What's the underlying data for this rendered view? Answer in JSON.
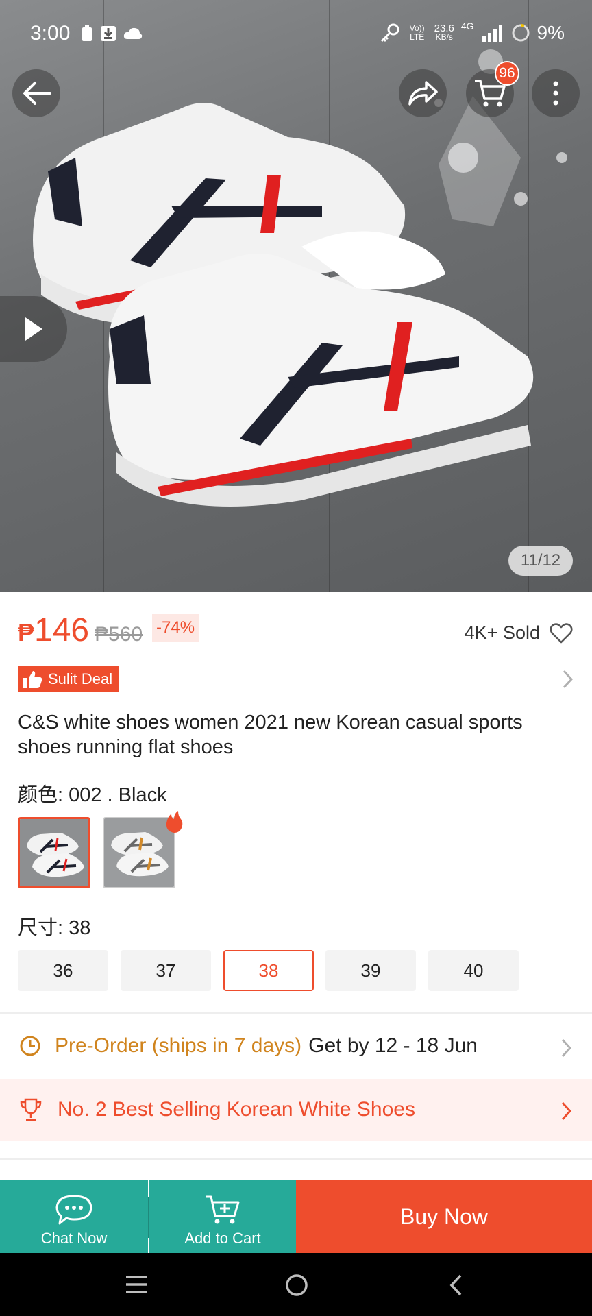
{
  "status_bar": {
    "time": "3:00",
    "network_label": "Vo)) LTE",
    "speed": "23.6",
    "speed_unit": "KB/s",
    "signal_label": "4G",
    "battery": "9%"
  },
  "gallery": {
    "counter": "11/12",
    "cart_count": "96"
  },
  "product": {
    "currency": "₱",
    "price": "146",
    "original_price": "₱560",
    "discount": "-74%",
    "sold": "4K+ Sold",
    "deal_label": "Sulit Deal",
    "title": "C&S white shoes women 2021 new Korean casual sports shoes running flat shoes"
  },
  "variants": {
    "color_label": "颜色: 002 . Black",
    "size_label": "尺寸: 38",
    "sizes": [
      "36",
      "37",
      "38",
      "39",
      "40"
    ],
    "selected_size": "38"
  },
  "shipping": {
    "preorder_text": "Pre-Order (ships in 7 days)",
    "delivery_text": "Get by 12 - 18 Jun"
  },
  "ranking": {
    "text": "No. 2 Best Selling Korean White Shoes"
  },
  "bottom_bar": {
    "chat_label": "Chat Now",
    "cart_label": "Add to Cart",
    "buy_label": "Buy Now"
  },
  "colors": {
    "accent": "#ee4d2d",
    "teal": "#26aa99",
    "preorder": "#d0841e"
  },
  "icons": [
    "back-arrow-icon",
    "share-icon",
    "cart-icon",
    "more-icon",
    "play-icon",
    "heart-icon",
    "chevron-right-icon",
    "clock-icon",
    "trophy-icon",
    "chat-icon",
    "add-cart-icon",
    "menu-icon",
    "home-icon",
    "back-nav-icon"
  ]
}
